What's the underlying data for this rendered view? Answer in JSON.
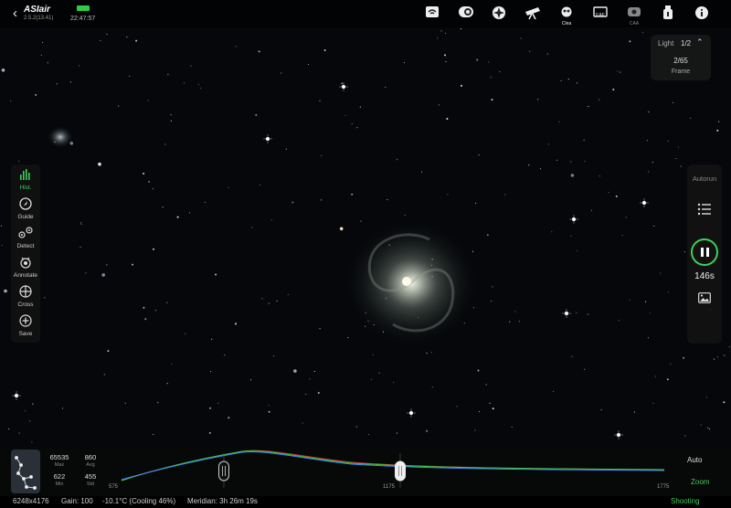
{
  "app": {
    "logo": "ASIair",
    "version": "2.5.2(13.41)",
    "time": "22:47:57"
  },
  "topbar": {
    "icons": [
      {
        "name": "wifi-icon"
      },
      {
        "name": "camera-icon"
      },
      {
        "name": "focuser-icon"
      },
      {
        "name": "telescope-icon"
      },
      {
        "name": "filter-wheel-icon",
        "label": "Clea"
      },
      {
        "name": "eaf-icon",
        "label": "EAF"
      },
      {
        "name": "guide-camera-icon",
        "label": "CAA"
      },
      {
        "name": "usb-icon"
      },
      {
        "name": "info-icon"
      }
    ]
  },
  "frame_panel": {
    "type_label": "Light",
    "page": "1/2",
    "count": "2/65",
    "frame_label": "Frame"
  },
  "left_tools": [
    {
      "label": "Hist.",
      "icon": "histogram-icon",
      "active": true
    },
    {
      "label": "Guide",
      "icon": "guide-icon"
    },
    {
      "label": "Detect",
      "icon": "detect-icon"
    },
    {
      "label": "Annotate",
      "icon": "annotate-icon"
    },
    {
      "label": "Cross",
      "icon": "crosshair-icon"
    },
    {
      "label": "Save",
      "icon": "save-icon"
    }
  ],
  "right_panel": {
    "autorun_label": "Autorun",
    "exposure_remaining": "146s"
  },
  "histogram": {
    "max": "65535",
    "max_label": "Max",
    "min": "622",
    "min_label": "Min",
    "avg": "860",
    "avg_label": "Avg",
    "std": "455",
    "std_label": "Std",
    "axis_left": "575",
    "axis_mid": "1175",
    "axis_right": "1775",
    "auto_label": "Auto",
    "zoom_label": "Zoom"
  },
  "status": {
    "resolution": "6248x4176",
    "gain": "Gain: 100",
    "cooling": "-10.1°C (Cooling 46%)",
    "meridian": "Meridian: 3h 26m 19s",
    "state": "Shooting"
  },
  "colors": {
    "accent": "#3ecf5a",
    "background": "#050608"
  }
}
